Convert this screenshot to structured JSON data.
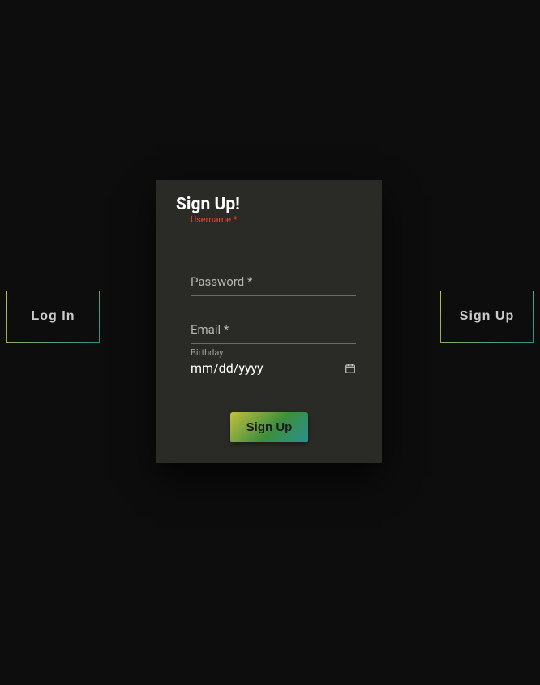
{
  "sideButtons": {
    "login": "Log In",
    "signup": "Sign Up"
  },
  "modal": {
    "title": "Sign Up!",
    "fields": {
      "username": {
        "label": "Username *",
        "value": ""
      },
      "password": {
        "label": "Password *",
        "value": ""
      },
      "email": {
        "label": "Email *",
        "value": ""
      },
      "birthday": {
        "label": "Birthday",
        "placeholder": "mm/dd/yyyy",
        "value": ""
      }
    },
    "submitLabel": "Sign Up"
  }
}
